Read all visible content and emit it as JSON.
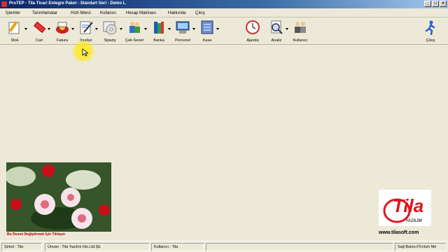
{
  "window": {
    "title": "ProTEP - Tila Ticari Entegre Paket - Standart Seri - Demo L"
  },
  "menu": [
    "İşlemler",
    "Tanımlamalar",
    "Hızlı Menü",
    "Kullanıcı",
    "Hesap Makinası",
    "Hakkında",
    "Çıkış"
  ],
  "toolbar": {
    "stok": "Stok",
    "cari": "Cari",
    "fatura": "Fatura",
    "irsaliye": "İrsaliye",
    "siparis": "Sipariş",
    "cek_senet": "Çek-Senet",
    "banka": "Banka",
    "personel": "Personel",
    "kasa": "Kasa",
    "ajanda": "Ajanda",
    "analiz": "Analiz",
    "kullanici": "Kullanıcı",
    "cikis": "Çıkış"
  },
  "image_caption": "Bu Resmi Değiştirmek İçin Tıklayın",
  "logo": {
    "brand": "Tila",
    "sub": "YAZILIM"
  },
  "website": "www.tilasoft.com",
  "status": {
    "sirket": "Şirket : Tila",
    "unvan": "Ünvan : Tila Yazılım Hiz.Ltd.Şti.",
    "kullanici": "Kullanıcı : Tila",
    "hint": "Sağ Buton,F5:Hızlı Me"
  },
  "colors": {
    "title_start": "#0a246a",
    "caption_red": "#b00000",
    "logo_red": "#e0141e",
    "highlight": "#ffeb00"
  }
}
